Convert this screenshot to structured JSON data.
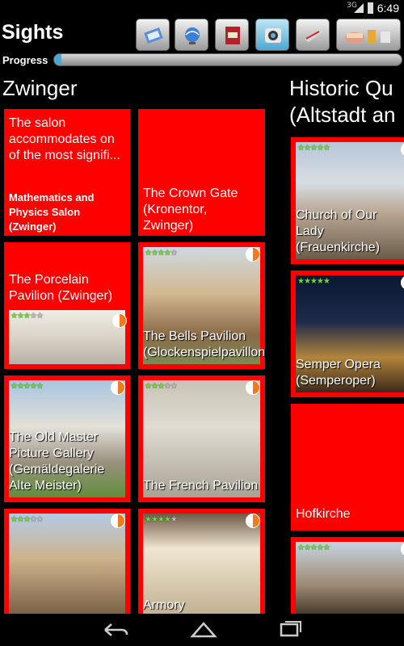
{
  "status_bar": {
    "network": "3G",
    "time": "6:49"
  },
  "app": {
    "title": "Sights"
  },
  "toolbar": {
    "buttons": [
      {
        "name": "map-icon"
      },
      {
        "name": "globe-icon"
      },
      {
        "name": "dictionary-icon"
      },
      {
        "name": "camera-icon",
        "active": true
      },
      {
        "name": "train-icon"
      },
      {
        "name": "food-icon"
      }
    ]
  },
  "progress": {
    "label": "Progress",
    "value_fraction": 0.02
  },
  "sections": [
    {
      "title": "Zwinger",
      "tiles": [
        {
          "description": "The salon accommodates on of the most signifi...",
          "name": "Mathematics and Physics Salon (Zwinger)"
        },
        {
          "name": "The Crown Gate (Kronentor, Zwinger)"
        },
        {
          "name": "The Porcelain Pavilion (Zwinger)",
          "rating": 3,
          "progress": 0.5
        },
        {
          "name": "The Bells Pavilion (Glockenspielpavillon)",
          "rating": 4,
          "progress": 0.5
        },
        {
          "name": "The Old Master Picture Gallery (Gemäldegalerie Alte Meister)",
          "rating": 5,
          "progress": 0.5
        },
        {
          "name": "The French Pavilion",
          "rating": 3,
          "progress": 0.5
        },
        {
          "name": "",
          "rating": 3,
          "progress": 0.5
        },
        {
          "name": "Armory",
          "rating": 4,
          "progress": 0.5
        }
      ]
    },
    {
      "title": "Historic Quarter (Altstadt and",
      "title_line2": "(Altstadt an",
      "title_line1": "Historic Qu",
      "tiles": [
        {
          "name": "Church of Our Lady (Frauenkirche)",
          "rating": 5
        },
        {
          "name": "Semper Opera (Semperoper)",
          "rating": 5
        },
        {
          "name": "Hofkirche"
        },
        {
          "name": "",
          "rating": 5
        }
      ]
    }
  ],
  "nav": {
    "back": "back-icon",
    "home": "home-icon",
    "recents": "recents-icon"
  }
}
